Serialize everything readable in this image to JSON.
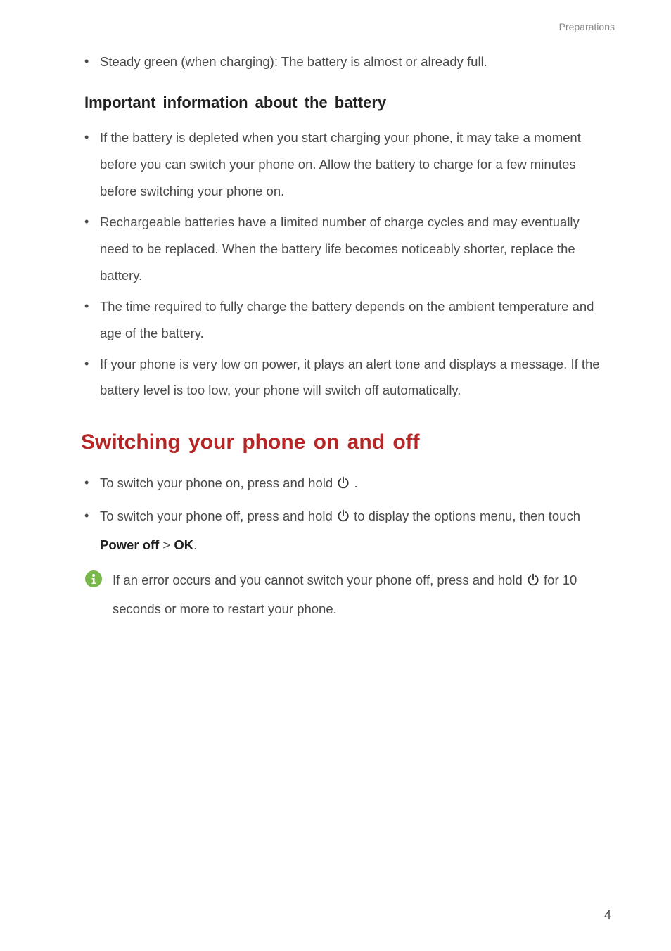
{
  "header": {
    "section_label": "Preparations"
  },
  "top_bullet": "Steady green (when charging): The battery is almost or already full.",
  "h3": "Important information about the battery",
  "battery_bullets": [
    "If the battery is depleted when you start charging your phone, it may take a moment before you can switch your phone on. Allow the battery to charge for a few minutes before switching your phone on.",
    "Rechargeable batteries have a limited number of charge cycles and may eventually need to be replaced. When the battery life becomes noticeably shorter, replace the battery.",
    "The time required to fully charge the battery depends on the ambient temperature and age of the battery.",
    "If your phone is very low on power, it plays an alert tone and displays a message. If the battery level is too low, your phone will switch off automatically."
  ],
  "h2": "Switching your phone on and off",
  "switch_bullets": {
    "b1_part1": "To switch your phone on, press and hold ",
    "b1_part2": ".",
    "b2_part1": "To switch your phone off, press and hold ",
    "b2_part2": " to display the options menu, then touch ",
    "b2_power_off": "Power off",
    "b2_gt": " > ",
    "b2_ok": "OK",
    "b2_part3": "."
  },
  "info_note": {
    "part1": "If an error occurs and you cannot switch your phone off, press and hold ",
    "part2": " for 10 seconds or more to restart your phone."
  },
  "page_number": "4"
}
